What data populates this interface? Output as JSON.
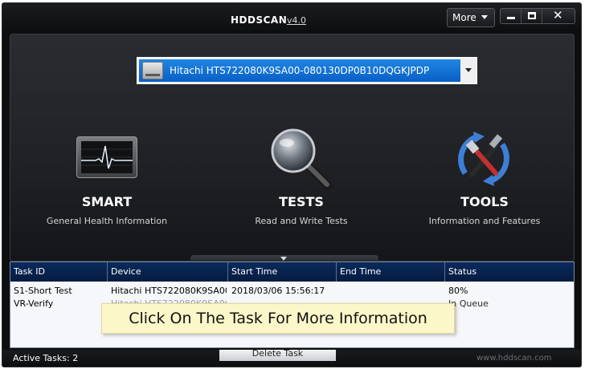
{
  "window": {
    "title": "HDDSCAN",
    "version": "v4.0",
    "more_label": "More",
    "close_glyph": "✕"
  },
  "drive": {
    "selected": "Hitachi HTS722080K9SA00-080130DP0B10DQGKJPDP"
  },
  "features": {
    "smart": {
      "title": "SMART",
      "subtitle": "General Health Information",
      "icon": "monitor-pulse-icon"
    },
    "tests": {
      "title": "TESTS",
      "subtitle": "Read and Write Tests",
      "icon": "magnifier-icon"
    },
    "tools": {
      "title": "TOOLS",
      "subtitle": "Information and Features",
      "icon": "tools-icon"
    }
  },
  "tasks": {
    "columns": [
      "Task ID",
      "Device",
      "Start Time",
      "End Time",
      "Status"
    ],
    "rows": [
      {
        "id": "S1-Short Test",
        "device": "Hitachi HTS722080K9SA00-...",
        "start": "2018/03/06 15:56:17",
        "end": "",
        "status": "80%"
      },
      {
        "id": "VR-Verify",
        "device": "Hitachi HTS722080K9SA00-...",
        "start": "",
        "end": "",
        "status": "In Queue"
      }
    ]
  },
  "tooltip": "Click On The Task For More Information",
  "status_bar": {
    "active_tasks": "Active Tasks: 2",
    "delete_label": "Delete Task",
    "site": "www.hddscan.com"
  },
  "colors": {
    "selection_blue": "#0a5fc7",
    "table_header": "#0a2a5c",
    "tooltip_bg": "#fcf7c8"
  }
}
